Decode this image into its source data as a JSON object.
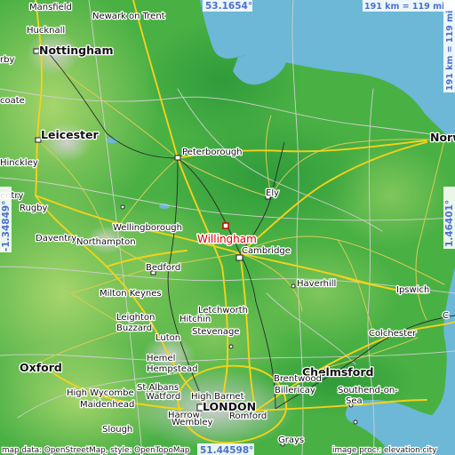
{
  "map": {
    "colors": {
      "sea": "#6cb8d6",
      "lowland_dark": "#2f9b3a",
      "lowland": "#49b044",
      "midland": "#7fc65a",
      "upland": "#a6d56c",
      "urban": "#c9c9c9",
      "marker": "#d40000",
      "coordinate_text": "#4b6fd1",
      "motorway": "#f4d21a"
    },
    "coordinates": {
      "top_lat": "53.1654°",
      "bottom_lat": "51.44598°",
      "left_lon": "-1.34849°",
      "right_lon": "1.46401°",
      "width_scale": "191 km = 119 mi",
      "height_scale": "191 km = 119 mi"
    },
    "marker": {
      "name": "Willingham",
      "icon": "square-marker-icon"
    },
    "cities": [
      {
        "id": "mansfield",
        "label": "Mansfield"
      },
      {
        "id": "newark",
        "label": "Newark on Trent"
      },
      {
        "id": "hucknall",
        "label": "Hucknall"
      },
      {
        "id": "nottingham",
        "label": "Nottingham"
      },
      {
        "id": "derby",
        "label": "rby"
      },
      {
        "id": "coate",
        "label": "coate"
      },
      {
        "id": "leicester",
        "label": "Leicester"
      },
      {
        "id": "hinckley",
        "label": "Hinckley"
      },
      {
        "id": "peterborough",
        "label": "Peterborough"
      },
      {
        "id": "norwich",
        "label": "Norw"
      },
      {
        "id": "coventry",
        "label": "entry"
      },
      {
        "id": "rugby",
        "label": "Rugby"
      },
      {
        "id": "ely",
        "label": "Ely"
      },
      {
        "id": "wellingborough",
        "label": "Wellingborough"
      },
      {
        "id": "daventry",
        "label": "Daventry"
      },
      {
        "id": "northampton",
        "label": "Northampton"
      },
      {
        "id": "cambridge",
        "label": "Cambridge"
      },
      {
        "id": "bedford",
        "label": "Bedford"
      },
      {
        "id": "haverhill",
        "label": "Haverhill"
      },
      {
        "id": "ipswich",
        "label": "Ipswich"
      },
      {
        "id": "milton-keynes",
        "label": "Milton Keynes"
      },
      {
        "id": "letchworth",
        "label": "Letchworth"
      },
      {
        "id": "hitchin",
        "label": "Hitchin"
      },
      {
        "id": "leighton-buzzard-1",
        "label": "Leighton"
      },
      {
        "id": "leighton-buzzard-2",
        "label": "Buzzard"
      },
      {
        "id": "stevenage",
        "label": "Stevenage"
      },
      {
        "id": "luton",
        "label": "Luton"
      },
      {
        "id": "colchester",
        "label": "Colchester"
      },
      {
        "id": "clacton",
        "label": "C"
      },
      {
        "id": "hemel-1",
        "label": "Hemel"
      },
      {
        "id": "hemel-2",
        "label": "Hempstead"
      },
      {
        "id": "oxford",
        "label": "Oxford"
      },
      {
        "id": "chelmsford",
        "label": "Chelmsford"
      },
      {
        "id": "st-albans",
        "label": "St Albans"
      },
      {
        "id": "watford",
        "label": "Watford"
      },
      {
        "id": "high-barnet",
        "label": "High Barnet"
      },
      {
        "id": "brentwood",
        "label": "Brentwood"
      },
      {
        "id": "high-wycombe",
        "label": "High Wycombe"
      },
      {
        "id": "harrow",
        "label": "Harrow"
      },
      {
        "id": "romford",
        "label": "Romford"
      },
      {
        "id": "billericay",
        "label": "Billericay"
      },
      {
        "id": "southend",
        "label": "Southend-on-"
      },
      {
        "id": "sea-suffix",
        "label": "Sea"
      },
      {
        "id": "maidenhead",
        "label": "Maidenhead"
      },
      {
        "id": "wembley",
        "label": "Wembley"
      },
      {
        "id": "slough",
        "label": "Slough"
      },
      {
        "id": "london",
        "label": "LONDON"
      },
      {
        "id": "grays",
        "label": "Grays"
      }
    ],
    "credits": {
      "left": "map data: OpenStreetMap, style: OpenTopoMap",
      "right": "image proc.: elevation.city"
    }
  }
}
